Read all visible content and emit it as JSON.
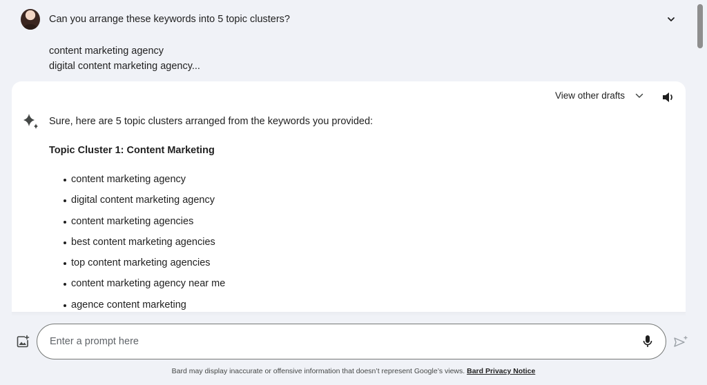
{
  "user": {
    "question": "Can you arrange these keywords into 5 topic clusters?",
    "lines": [
      "content marketing agency",
      "digital content marketing agency..."
    ]
  },
  "response": {
    "drafts_label": "View other drafts",
    "intro": "Sure, here are 5 topic clusters arranged from the keywords you provided:",
    "heading": "Topic Cluster 1: Content Marketing",
    "bullets": [
      "content marketing agency",
      "digital content marketing agency",
      "content marketing agencies",
      "best content marketing agencies",
      "top content marketing agencies",
      "content marketing agency near me",
      "agence content marketing"
    ]
  },
  "input": {
    "placeholder": "Enter a prompt here"
  },
  "footer": {
    "disclaimer": "Bard may display inaccurate or offensive information that doesn’t represent Google’s views.",
    "link": "Bard Privacy Notice"
  },
  "icons": {
    "avatar": "user-avatar",
    "expand": "chevron-down-icon",
    "drafts": "chevron-down-icon",
    "speaker": "speaker-icon",
    "sparkle": "sparkle-icon",
    "image": "add-image-icon",
    "mic": "mic-icon",
    "send": "send-icon"
  },
  "colors": {
    "background": "#f0f2f7",
    "card": "#ffffff",
    "text": "#1f1f1f"
  }
}
